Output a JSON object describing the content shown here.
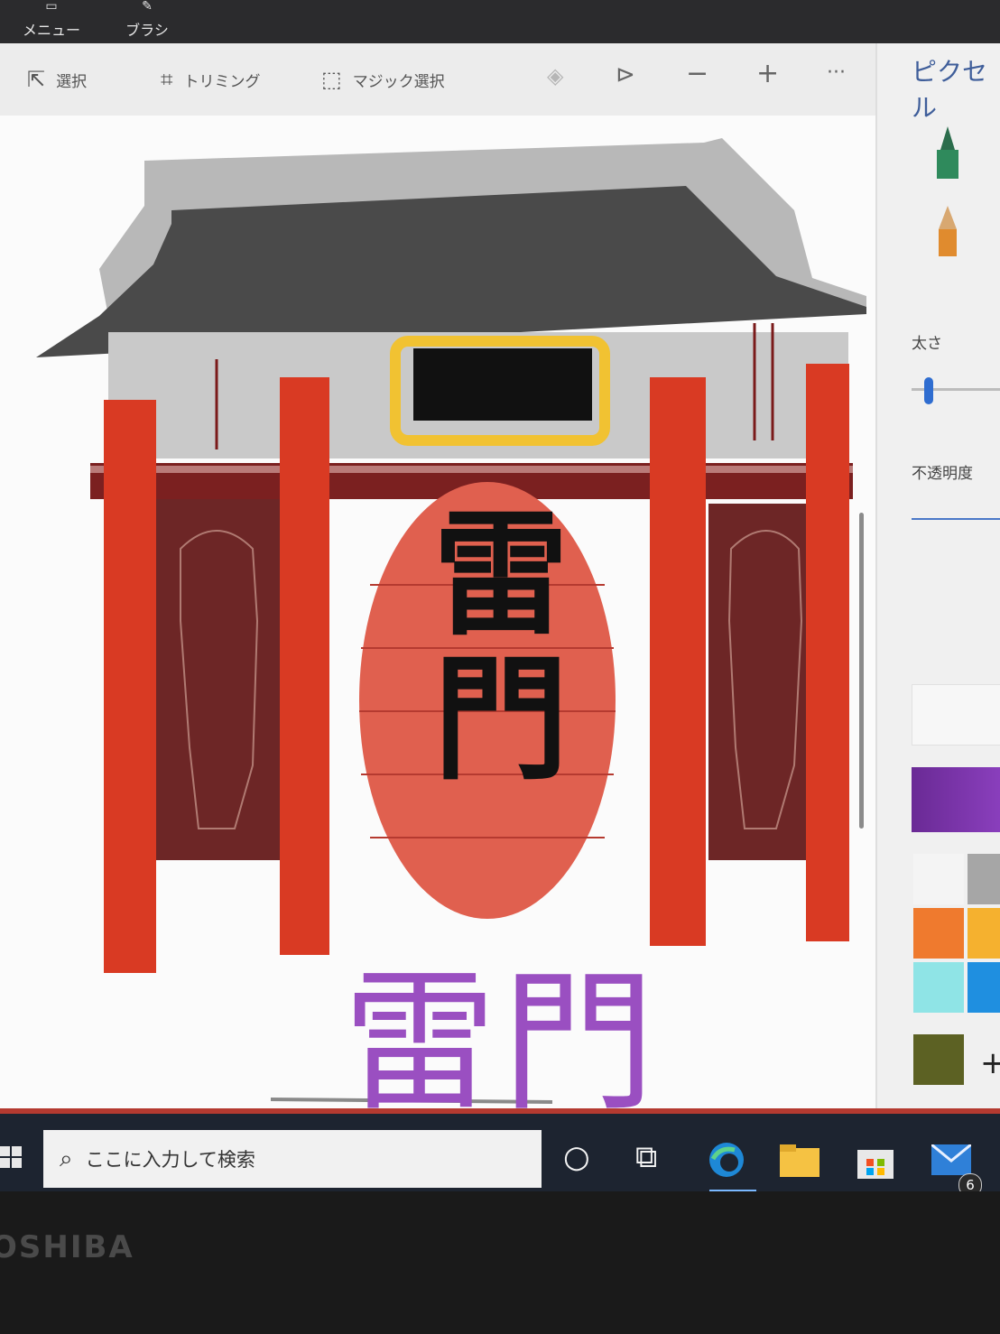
{
  "app_menu": {
    "menu_label": "メニュー",
    "brush_label": "ブラシ"
  },
  "toolbar": {
    "select_label": "選択",
    "crop_label": "トリミング",
    "magic_select_label": "マジック選択",
    "more_label": "···"
  },
  "panel": {
    "title": "ピクセル",
    "thickness_label": "太さ",
    "opacity_label": "不透明度",
    "palette": [
      "#f4f4f4",
      "#a6a6a6",
      "#ef7a2e",
      "#f5b12f",
      "#8fe4e6",
      "#1f8fe0",
      "#5c6123"
    ],
    "current_color": "#7a33a8"
  },
  "drawing": {
    "lantern_text": "雷門",
    "signature_text": "雷門"
  },
  "taskbar": {
    "search_placeholder": "ここに入力して検索",
    "mail_badge": "6"
  },
  "bezel": {
    "brand": "OSHIBA"
  },
  "colors": {
    "pillar": "#d93a23",
    "roof": "#4a4a4a",
    "banner": "#6d2626",
    "lantern": "#e0604f",
    "plaque_border": "#f1c232",
    "signature": "#9a4fc1"
  }
}
